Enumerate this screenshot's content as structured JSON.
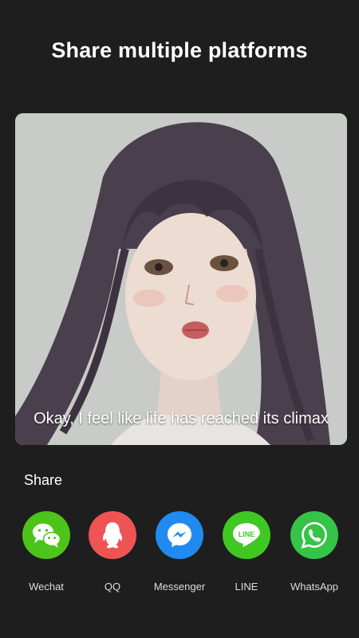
{
  "header": {
    "title": "Share multiple platforms"
  },
  "preview": {
    "caption": "Okay, I feel like life has reached its climax"
  },
  "share": {
    "label": "Share",
    "items": [
      {
        "label": "Wechat",
        "icon": "wechat-icon",
        "color": "#4cc419"
      },
      {
        "label": "QQ",
        "icon": "qq-icon",
        "color": "#ef5455"
      },
      {
        "label": "Messenger",
        "icon": "messenger-icon",
        "color": "#1f8bf0"
      },
      {
        "label": "LINE",
        "icon": "line-icon",
        "color": "#3fc822"
      },
      {
        "label": "WhatsApp",
        "icon": "whatsapp-icon",
        "color": "#35c447"
      }
    ]
  },
  "colors": {
    "background": "#1e1e1e",
    "text": "#ffffff"
  }
}
